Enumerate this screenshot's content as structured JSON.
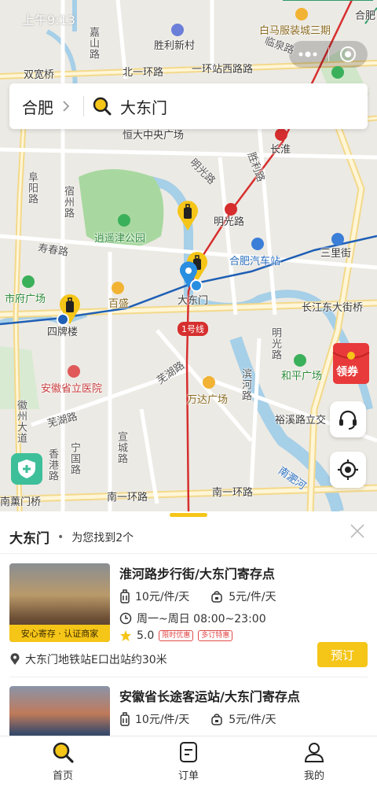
{
  "status_time": "上午9:13",
  "map": {
    "labels": {
      "jiashan_road": "嘉山路",
      "shengli_xincun": "胜利新村",
      "baima_fuzhuang": "白马服装城三期",
      "hefei_corner": "合肥",
      "linquan_road": "临泉路",
      "shuangkuan_bridge": "双宽桥",
      "beiyihuan_road": "北一环路",
      "yihuan_road": "一环路",
      "yihuanzhan_road": "一环站西路路",
      "hengda_plaza": "恒大中央广场",
      "changhuai": "长淮",
      "fuyang_road": "阜阳路",
      "suzhou_road": "宿州路",
      "mingguang_road_a": "明光路",
      "mingguang_road_b": "明光路",
      "shengli_road": "胜利路",
      "xiaoyaojin_park": "逍遥津公园",
      "shouchun_road": "寿春路",
      "hefei_bus_station": "合肥汽车站",
      "sanli_street": "三里街",
      "shifu_plaza": "市府广场",
      "baisheng": "百盛",
      "dadongmen": "大东门",
      "changjiang_bridge": "长江东大街桥",
      "sipailou": "四牌楼",
      "line1": "1号线",
      "mingguang_road_c": "明光路",
      "wuhu_road_a": "芜湖路",
      "binhe_road": "滨河路",
      "heping_plaza": "和平广场",
      "anhui_hospital": "安徽省立医院",
      "wanda_plaza": "万达广场",
      "huizhou_avenue": "徽州大道",
      "wuhu_road_b": "芜湖路",
      "ningguo_road": "宁国路",
      "xuancheng_road": "宣城路",
      "xiangfu_road": "香港路",
      "yuxi_road": "裕溪路立交",
      "nanyihuan_road_a": "南一环路",
      "nanyihuan_road_b": "南一环路",
      "nanfeihe": "南淝河",
      "nanmen": "南薰门桥"
    }
  },
  "search": {
    "city": "合肥",
    "query": "大东门"
  },
  "coupon_label": "领券",
  "panel": {
    "title": "大东门",
    "subtitle": "为您找到2个",
    "cards": [
      {
        "title": "淮河路步行街/大东门寄存点",
        "price_large": "10元/件/天",
        "price_small": "5元/件/天",
        "hours": "周一~周日 08:00~23:00",
        "rating": "5.0",
        "tag1": "限时优惠",
        "tag2": "多订特惠",
        "badge": "安心寄存 · 认证商家",
        "location": "大东门地铁站E口出站约30米",
        "book_label": "预订"
      },
      {
        "title": "安徽省长途客运站/大东门寄存点",
        "price_large": "10元/件/天",
        "price_small": "5元/件/天"
      }
    ]
  },
  "tabs": [
    {
      "label": "首页",
      "icon": "search-icon",
      "active": true
    },
    {
      "label": "订单",
      "icon": "order-icon",
      "active": false
    },
    {
      "label": "我的",
      "icon": "profile-icon",
      "active": false
    }
  ],
  "colors": {
    "accent": "#f5c518",
    "metro_red": "#d62e2e",
    "metro_blue": "#1f5fb5",
    "park_green": "#a8d8a0",
    "water": "#a6cfe8"
  }
}
